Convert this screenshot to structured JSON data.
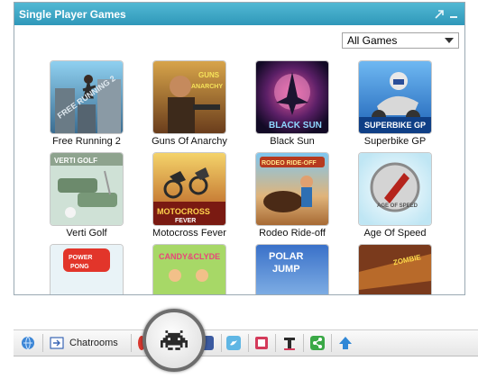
{
  "panel": {
    "title": "Single Player Games",
    "expand_icon": "expand-arrow-icon",
    "minimize_icon": "minimize-icon"
  },
  "filter": {
    "selected": "All Games"
  },
  "games": [
    {
      "name": "Free Running 2",
      "thumb_text": "FREE RUNNING 2"
    },
    {
      "name": "Guns Of Anarchy",
      "thumb_text": "GUNS OF ANARCHY"
    },
    {
      "name": "Black Sun",
      "thumb_text": "BLACK SUN"
    },
    {
      "name": "Superbike GP",
      "thumb_text": "SUPERBIKE GP"
    },
    {
      "name": "Verti Golf",
      "thumb_text": "VERTI GOLF"
    },
    {
      "name": "Motocross Fever",
      "thumb_text": "MOTOCROSS FEVER"
    },
    {
      "name": "Rodeo Ride-off",
      "thumb_text": "RODEO RIDE-OFF"
    },
    {
      "name": "Age Of Speed",
      "thumb_text": "AGE OF SPEED"
    },
    {
      "name": "",
      "thumb_text": "POWER PONG"
    },
    {
      "name": "",
      "thumb_text": "CANDY & CLYDE"
    },
    {
      "name": "",
      "thumb_text": "POLAR JUMP"
    },
    {
      "name": "",
      "thumb_text": ""
    }
  ],
  "toolbar": {
    "chatrooms_label": "Chatrooms",
    "icons": [
      "globe-icon",
      "chatrooms-icon",
      "games-invader-icon",
      "facebook-icon",
      "twitter-icon",
      "notes-icon",
      "text-icon",
      "share-icon",
      "scroll-up-icon"
    ]
  },
  "colors": {
    "header": "#3aa6c6",
    "twitter": "#5fb6e4",
    "share": "#3aa846",
    "up": "#2f87d6"
  }
}
